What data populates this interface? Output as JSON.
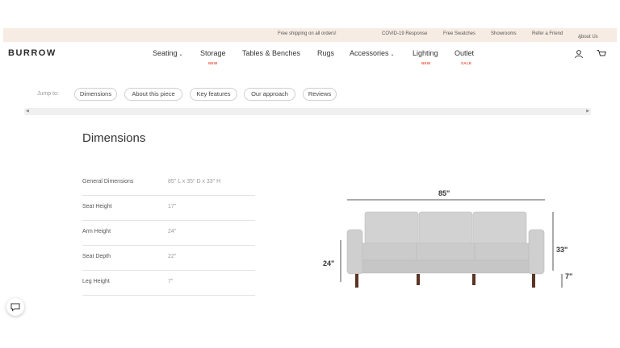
{
  "announcement": {
    "shipping": "Free shipping on all orders!",
    "links": [
      "COVID-19 Response",
      "Free Swatches",
      "Showrooms",
      "Refer a Friend",
      "About Us"
    ]
  },
  "brand": "BURROW",
  "nav": {
    "seating": "Seating",
    "storage": "Storage",
    "storage_badge": "NEW",
    "tables": "Tables & Benches",
    "rugs": "Rugs",
    "accessories": "Accessories",
    "lighting": "Lighting",
    "lighting_badge": "NEW",
    "outlet": "Outlet",
    "outlet_badge": "SALE",
    "chevron": "⌄"
  },
  "jump": {
    "label": "Jump to:",
    "items": [
      "Dimensions",
      "About this piece",
      "Key features",
      "Our approach",
      "Reviews"
    ]
  },
  "dimensions": {
    "title": "Dimensions",
    "rows": [
      {
        "label": "General Dimensions",
        "value": "85\" L x 35\" D x 33\" H"
      },
      {
        "label": "Seat Height",
        "value": "17\""
      },
      {
        "label": "Arm Height",
        "value": "24\""
      },
      {
        "label": "Seat Depth",
        "value": "22\""
      },
      {
        "label": "Leg Height",
        "value": "7\""
      }
    ]
  },
  "diagram": {
    "width": "85\"",
    "arm": "24\"",
    "height": "33\"",
    "leg": "7\""
  },
  "colors": {
    "topbar": "#f7ece3",
    "badge": "#e8573b",
    "sofa": "#d2d2d2",
    "legs": "#5a3424"
  }
}
